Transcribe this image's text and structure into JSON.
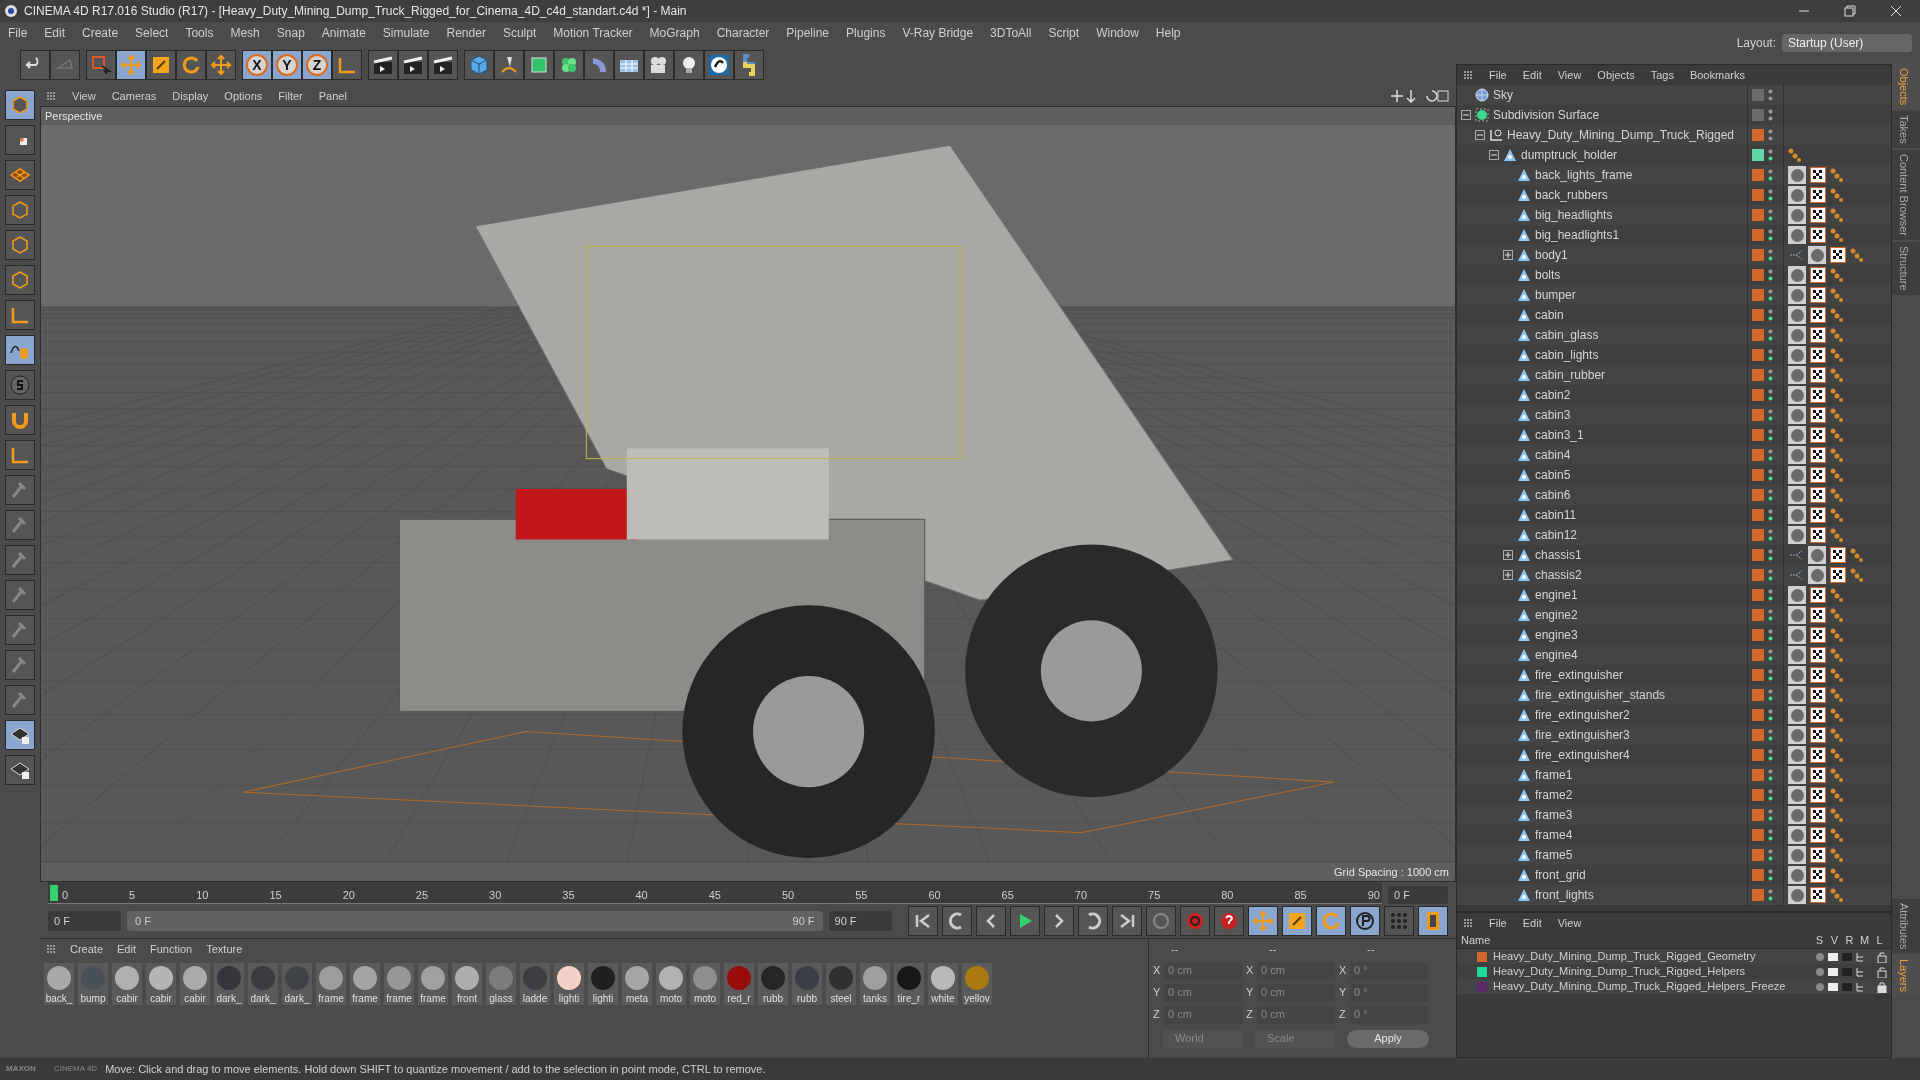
{
  "window": {
    "title": "CINEMA 4D R17.016 Studio (R17) - [Heavy_Duty_Mining_Dump_Truck_Rigged_for_Cinema_4D_c4d_standart.c4d *] - Main"
  },
  "menu": [
    "File",
    "Edit",
    "Create",
    "Select",
    "Tools",
    "Mesh",
    "Snap",
    "Animate",
    "Simulate",
    "Render",
    "Sculpt",
    "Motion Tracker",
    "MoGraph",
    "Character",
    "Pipeline",
    "Plugins",
    "V-Ray Bridge",
    "3DToAll",
    "Script",
    "Window",
    "Help"
  ],
  "layout": {
    "label": "Layout:",
    "value": "Startup (User)"
  },
  "axis_buttons": [
    {
      "label": "X",
      "selected": true
    },
    {
      "label": "Y",
      "selected": true
    },
    {
      "label": "Z",
      "selected": true
    }
  ],
  "viewport": {
    "menu": [
      "View",
      "Cameras",
      "Display",
      "Options",
      "Filter",
      "Panel"
    ],
    "camera": "Perspective",
    "grid_spacing": "Grid Spacing : 1000 cm"
  },
  "timeline": {
    "ticks": [
      "0",
      "5",
      "10",
      "15",
      "20",
      "25",
      "30",
      "35",
      "40",
      "45",
      "50",
      "55",
      "60",
      "65",
      "70",
      "75",
      "80",
      "85",
      "90"
    ],
    "current_frame": "0 F",
    "range_start": "0 F",
    "range_end": "90 F",
    "end_frame": "90 F",
    "frame_field": "0 F",
    "level": 1
  },
  "materials": {
    "menu": [
      "Create",
      "Edit",
      "Function",
      "Texture"
    ],
    "items": [
      {
        "name": "back_",
        "color": "#a8a8a8"
      },
      {
        "name": "bump",
        "color": "#4a5058"
      },
      {
        "name": "cabir",
        "color": "#b0b0b0"
      },
      {
        "name": "cabir",
        "color": "#b4b4b4"
      },
      {
        "name": "cabir",
        "color": "#aaaaaa"
      },
      {
        "name": "dark_",
        "color": "#34363a"
      },
      {
        "name": "dark_",
        "color": "#3a3c40"
      },
      {
        "name": "dark_",
        "color": "#404448"
      },
      {
        "name": "frame",
        "color": "#9c9c9c"
      },
      {
        "name": "frame",
        "color": "#a4a4a4"
      },
      {
        "name": "frame",
        "color": "#989898"
      },
      {
        "name": "frame",
        "color": "#a0a0a0"
      },
      {
        "name": "front",
        "color": "#aeaeae"
      },
      {
        "name": "glass",
        "color": "#7c7c7c"
      },
      {
        "name": "ladde",
        "color": "#3c3e42"
      },
      {
        "name": "lighti",
        "color": "#f4d2c8"
      },
      {
        "name": "lighti",
        "color": "#202020"
      },
      {
        "name": "meta",
        "color": "#a6a6a6"
      },
      {
        "name": "moto",
        "color": "#b2b2b2"
      },
      {
        "name": "moto",
        "color": "#8e8e8e"
      },
      {
        "name": "red_r",
        "color": "#9a0c0c"
      },
      {
        "name": "rubb",
        "color": "#262626"
      },
      {
        "name": "rubb",
        "color": "#3a3e46"
      },
      {
        "name": "steel",
        "color": "#303030"
      },
      {
        "name": "tanks",
        "color": "#9e9e9e"
      },
      {
        "name": "tire_r",
        "color": "#181818"
      },
      {
        "name": "white",
        "color": "#b8b8b8"
      },
      {
        "name": "yellov",
        "color": "#a87a10"
      }
    ]
  },
  "coordinates": {
    "headers": [
      "--",
      "--",
      "--"
    ],
    "rows": [
      {
        "labels": [
          "X",
          "X",
          "X"
        ],
        "values": [
          "0 cm",
          "0 cm",
          "0 °"
        ]
      },
      {
        "labels": [
          "Y",
          "Y",
          "Y"
        ],
        "values": [
          "0 cm",
          "0 cm",
          "0 °"
        ]
      },
      {
        "labels": [
          "Z",
          "Z",
          "Z"
        ],
        "values": [
          "0 cm",
          "0 cm",
          "0 °"
        ]
      }
    ],
    "mode": "World",
    "transform": "Scale",
    "apply": "Apply"
  },
  "object_manager": {
    "menu": [
      "File",
      "Edit",
      "View",
      "Objects",
      "Tags",
      "Bookmarks"
    ],
    "objects": [
      {
        "name": "Sky",
        "kind": "sky",
        "color": "#6a6a6a"
      },
      {
        "name": "Subdivision Surface",
        "kind": "generator",
        "color": "#6a6a6a",
        "expanded": true,
        "children": [
          {
            "name": "Heavy_Duty_Mining_Dump_Truck_Rigged",
            "kind": "null",
            "color": "#d0692a",
            "expanded": true,
            "children": [
              {
                "name": "dumptruck_holder",
                "kind": "holder",
                "color": "#5fd8a6",
                "expanded": true,
                "children": [
                  {
                    "name": "back_lights_frame",
                    "kind": "polygon",
                    "color": "#d0692a"
                  },
                  {
                    "name": "back_rubbers",
                    "kind": "polygon",
                    "color": "#d0692a"
                  },
                  {
                    "name": "big_headlights",
                    "kind": "polygon",
                    "color": "#d0692a"
                  },
                  {
                    "name": "big_headlights1",
                    "kind": "polygon",
                    "color": "#d0692a"
                  },
                  {
                    "name": "body1",
                    "kind": "polygon",
                    "color": "#d0692a",
                    "expanded": false
                  },
                  {
                    "name": "bolts",
                    "kind": "polygon",
                    "color": "#d0692a"
                  },
                  {
                    "name": "bumper",
                    "kind": "polygon",
                    "color": "#d0692a"
                  },
                  {
                    "name": "cabin",
                    "kind": "polygon",
                    "color": "#d0692a"
                  },
                  {
                    "name": "cabin_glass",
                    "kind": "polygon",
                    "color": "#d0692a"
                  },
                  {
                    "name": "cabin_lights",
                    "kind": "polygon",
                    "color": "#d0692a"
                  },
                  {
                    "name": "cabin_rubber",
                    "kind": "polygon",
                    "color": "#d0692a"
                  },
                  {
                    "name": "cabin2",
                    "kind": "polygon",
                    "color": "#d0692a"
                  },
                  {
                    "name": "cabin3",
                    "kind": "polygon",
                    "color": "#d0692a"
                  },
                  {
                    "name": "cabin3_1",
                    "kind": "polygon",
                    "color": "#d0692a"
                  },
                  {
                    "name": "cabin4",
                    "kind": "polygon",
                    "color": "#d0692a"
                  },
                  {
                    "name": "cabin5",
                    "kind": "polygon",
                    "color": "#d0692a"
                  },
                  {
                    "name": "cabin6",
                    "kind": "polygon",
                    "color": "#d0692a"
                  },
                  {
                    "name": "cabin11",
                    "kind": "polygon",
                    "color": "#d0692a"
                  },
                  {
                    "name": "cabin12",
                    "kind": "polygon",
                    "color": "#d0692a"
                  },
                  {
                    "name": "chassis1",
                    "kind": "polygon",
                    "color": "#d0692a",
                    "expanded": false
                  },
                  {
                    "name": "chassis2",
                    "kind": "polygon",
                    "color": "#d0692a",
                    "expanded": false
                  },
                  {
                    "name": "engine1",
                    "kind": "polygon",
                    "color": "#d0692a"
                  },
                  {
                    "name": "engine2",
                    "kind": "polygon",
                    "color": "#d0692a"
                  },
                  {
                    "name": "engine3",
                    "kind": "polygon",
                    "color": "#d0692a"
                  },
                  {
                    "name": "engine4",
                    "kind": "polygon",
                    "color": "#d0692a"
                  },
                  {
                    "name": "fire_extinguisher",
                    "kind": "polygon",
                    "color": "#d0692a"
                  },
                  {
                    "name": "fire_extinguisher_stands",
                    "kind": "polygon",
                    "color": "#d0692a"
                  },
                  {
                    "name": "fire_extinguisher2",
                    "kind": "polygon",
                    "color": "#d0692a"
                  },
                  {
                    "name": "fire_extinguisher3",
                    "kind": "polygon",
                    "color": "#d0692a"
                  },
                  {
                    "name": "fire_extinguisher4",
                    "kind": "polygon",
                    "color": "#d0692a"
                  },
                  {
                    "name": "frame1",
                    "kind": "polygon",
                    "color": "#d0692a"
                  },
                  {
                    "name": "frame2",
                    "kind": "polygon",
                    "color": "#d0692a"
                  },
                  {
                    "name": "frame3",
                    "kind": "polygon",
                    "color": "#d0692a"
                  },
                  {
                    "name": "frame4",
                    "kind": "polygon",
                    "color": "#d0692a"
                  },
                  {
                    "name": "frame5",
                    "kind": "polygon",
                    "color": "#d0692a"
                  },
                  {
                    "name": "front_grid",
                    "kind": "polygon",
                    "color": "#d0692a"
                  },
                  {
                    "name": "front_lights",
                    "kind": "polygon",
                    "color": "#d0692a"
                  }
                ]
              }
            ]
          }
        ]
      }
    ]
  },
  "side_tabs_top": [
    {
      "label": "Objects",
      "selected": true
    },
    {
      "label": "Takes",
      "selected": false
    },
    {
      "label": "Content Browser",
      "selected": false
    },
    {
      "label": "Structure",
      "selected": false
    }
  ],
  "layers": {
    "menu": [
      "File",
      "Edit",
      "View"
    ],
    "columns": [
      "Name",
      "S",
      "V",
      "R",
      "M",
      "L"
    ],
    "rows": [
      {
        "name": "Heavy_Duty_Mining_Dump_Truck_Rigged_Geometry",
        "color": "#d0692a",
        "locked": false
      },
      {
        "name": "Heavy_Duty_Mining_Dump_Truck_Rigged_Helpers",
        "color": "#1ed89a",
        "locked": false
      },
      {
        "name": "Heavy_Duty_Mining_Dump_Truck_Rigged_Helpers_Freeze",
        "color": "#5a2a6a",
        "locked": true
      }
    ]
  },
  "side_tabs_bottom": [
    {
      "label": "Attributes",
      "selected": false
    },
    {
      "label": "Layers",
      "selected": true
    }
  ],
  "logo": {
    "brand": "MAXON",
    "product": "CINEMA 4D"
  },
  "status_bar": "Move: Click and drag to move elements. Hold down SHIFT to quantize movement / add to the selection in point mode, CTRL to remove."
}
